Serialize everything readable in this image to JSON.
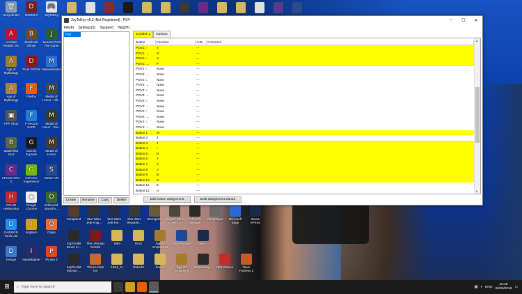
{
  "window": {
    "title": "JoyToKey v6.3 (Not Registered) : PS4",
    "controls": {
      "minimize": "–",
      "maximize": "☐",
      "close": "✕"
    }
  },
  "menu": [
    "File(F)",
    "Settings(S)",
    "Suspend",
    "Help(H)"
  ],
  "profiles": [
    "PS4"
  ],
  "profile_buttons": [
    "Create",
    "Rename",
    "Copy",
    "Delete"
  ],
  "tabs": [
    "Joystick 1",
    "Options"
  ],
  "grid": {
    "headers": [
      "Button",
      "Function",
      "Auto",
      "Comment"
    ],
    "rows": [
      {
        "button": "POV1: ↑",
        "function": "T",
        "auto": "---",
        "hl": true
      },
      {
        "button": "POV1: →",
        "function": "G",
        "auto": "---",
        "hl": true
      },
      {
        "button": "POV1: ↓",
        "function": "V",
        "auto": "---",
        "hl": true
      },
      {
        "button": "POV1: ←",
        "function": "F",
        "auto": "---",
        "hl": true
      },
      {
        "button": "POV2: ↑",
        "function": "None",
        "auto": "---",
        "hl": false
      },
      {
        "button": "POV2: →",
        "function": "None",
        "auto": "---",
        "hl": false
      },
      {
        "button": "POV2: ↓",
        "function": "None",
        "auto": "---",
        "hl": false
      },
      {
        "button": "POV2: ←",
        "function": "None",
        "auto": "---",
        "hl": false
      },
      {
        "button": "POV3: ↑",
        "function": "None",
        "auto": "---",
        "hl": false
      },
      {
        "button": "POV3: →",
        "function": "None",
        "auto": "---",
        "hl": false
      },
      {
        "button": "POV3: ↓",
        "function": "None",
        "auto": "---",
        "hl": false
      },
      {
        "button": "POV3: ←",
        "function": "None",
        "auto": "---",
        "hl": false
      },
      {
        "button": "POV4: ↑",
        "function": "None",
        "auto": "---",
        "hl": false
      },
      {
        "button": "POV4: →",
        "function": "None",
        "auto": "---",
        "hl": false
      },
      {
        "button": "POV4: ↓",
        "function": "None",
        "auto": "---",
        "hl": false
      },
      {
        "button": "POV4: ←",
        "function": "None",
        "auto": "---",
        "hl": false
      },
      {
        "button": "Button 1",
        "function": "M",
        "auto": "---",
        "hl": true
      },
      {
        "button": "Button 2",
        "function": "4",
        "auto": "---",
        "hl": false
      },
      {
        "button": "Button 3",
        "function": "J",
        "auto": "---",
        "hl": true
      },
      {
        "button": "Button 4",
        "function": "I",
        "auto": "---",
        "hl": true
      },
      {
        "button": "Button 5",
        "function": "B",
        "auto": "---",
        "hl": true
      },
      {
        "button": "Button 6",
        "function": "Y",
        "auto": "---",
        "hl": true
      },
      {
        "button": "Button 7",
        "function": "C",
        "auto": "---",
        "hl": true
      },
      {
        "button": "Button 8",
        "function": "V",
        "auto": "---",
        "hl": true
      },
      {
        "button": "Button 9",
        "function": "B",
        "auto": "---",
        "hl": true
      },
      {
        "button": "Button 10",
        "function": "N",
        "auto": "---",
        "hl": true
      },
      {
        "button": "Button 11",
        "function": "E",
        "auto": "---",
        "hl": false
      },
      {
        "button": "Button 12",
        "function": "U",
        "auto": "---",
        "hl": false
      }
    ]
  },
  "assignment_buttons": [
    "Edit button assignment",
    "Bulk assignment wizard"
  ],
  "desktop_icons": [
    {
      "label": "Recycle Bin",
      "color": "#8aa0b8",
      "glyph": "🗑"
    },
    {
      "label": "DOOM 3",
      "color": "#7a1e1e",
      "glyph": "D"
    },
    {
      "label": "JoyToKey",
      "color": "#e6e6e6",
      "glyph": "🎮"
    },
    {
      "label": "Acrobat Reader DC",
      "color": "#c8102e",
      "glyph": "A"
    },
    {
      "label": "BioShock Infinite",
      "color": "#6b4a2e",
      "glyph": "B"
    },
    {
      "label": "Jurassic Park The Game",
      "color": "#2e5d2e",
      "glyph": "J"
    },
    {
      "label": "Age of Mythology",
      "color": "#a87b2c",
      "glyph": "A"
    },
    {
      "label": "Final DOOM",
      "color": "#8b1a1a",
      "glyph": "D"
    },
    {
      "label": "Malwarebytes",
      "color": "#2a6fd6",
      "glyph": "M"
    },
    {
      "label": "Age of Mythology",
      "color": "#b08432",
      "glyph": "A"
    },
    {
      "label": "Firefox",
      "color": "#e66000",
      "glyph": "F"
    },
    {
      "label": "Medal of Honor - Alli...",
      "color": "#4a4a3a",
      "glyph": "M"
    },
    {
      "label": "APP Shop",
      "color": "#555555",
      "glyph": "▣"
    },
    {
      "label": "F-Secure SAFE",
      "color": "#1f7ed6",
      "glyph": "F"
    },
    {
      "label": "Medal of Honor - Bre...",
      "color": "#3a3a2a",
      "glyph": "M"
    },
    {
      "label": "Battlefield 1942",
      "color": "#5a6a3a",
      "glyph": "B"
    },
    {
      "label": "Garmin Express",
      "color": "#1a1a1a",
      "glyph": "G"
    },
    {
      "label": "Medal of Honor",
      "color": "#4a3a2a",
      "glyph": "M"
    },
    {
      "label": "CPUID CPU-Z",
      "color": "#6a2a8a",
      "glyph": "C"
    },
    {
      "label": "GeForce Experience",
      "color": "#76b900",
      "glyph": "G"
    },
    {
      "label": "Steam VR",
      "color": "#2a4a8a",
      "glyph": "S"
    },
    {
      "label": "CPUID HWMonitor",
      "color": "#c82a2a",
      "glyph": "H"
    },
    {
      "label": "Google Chrome",
      "color": "#f0f0f0",
      "glyph": "◉"
    },
    {
      "label": "Oddworld: Munch's...",
      "color": "#3a6a2a",
      "glyph": "O"
    },
    {
      "label": "DAEMON Tools Lite",
      "color": "#1e90ff",
      "glyph": "D"
    },
    {
      "label": "ImgBurn",
      "color": "#d4a017",
      "glyph": "I"
    },
    {
      "label": "Origin",
      "color": "#f56c2d",
      "glyph": "O"
    },
    {
      "label": "Deluge",
      "color": "#3a7ad6",
      "glyph": "D"
    },
    {
      "label": "InputMapper",
      "color": "#2a2a6a",
      "glyph": "I"
    },
    {
      "label": "Picasa 3",
      "color": "#d64a2a",
      "glyph": "P"
    }
  ],
  "row_icons": [
    {
      "label": "Scrapland",
      "color": "#5a3a2a"
    },
    {
      "label": "Star Wars Jedi Knig...",
      "color": "#333333"
    },
    {
      "label": "Star Wars Jedi Kni...",
      "color": "#2a2a4a"
    },
    {
      "label": "Star Wars Republic...",
      "color": "#3a3a3a"
    },
    {
      "label": "Stronghold",
      "color": "#6a5a3a"
    },
    {
      "label": "Project IGI 2 Covert ...",
      "color": "#4a4a3a"
    },
    {
      "label": "7-Zip File Manager",
      "color": "#2a2a2a"
    },
    {
      "label": "Rashplayer",
      "color": "#6a6a6a"
    },
    {
      "label": "Microsoft Edge",
      "color": "#2a6ad6"
    },
    {
      "label": "Steam ePSXe",
      "color": "#1a2a4a"
    },
    {
      "label": "ScpToolkit Driver In...",
      "color": "#2a2a2a"
    },
    {
      "label": "The Ultimate DOOM",
      "color": "#7a1a1a"
    },
    {
      "label": "1964",
      "color": "#d4b85a"
    },
    {
      "label": "Docs",
      "color": "#d4b85a"
    },
    {
      "label": "Age of Empires III",
      "color": "#a87b2c"
    },
    {
      "label": "GameRanger",
      "color": "#1a4a9a"
    },
    {
      "label": "Steam...",
      "color": "#1a2a4a"
    },
    {
      "label": "ScpToolkit Monitor ...",
      "color": "#2a2a2a"
    },
    {
      "label": "Theme Park Inc",
      "color": "#c86a2a"
    },
    {
      "label": "1964_11",
      "color": "#d4b85a"
    },
    {
      "label": "Duke3d",
      "color": "#d4b85a"
    },
    {
      "label": "Sound",
      "color": "#d4b85a"
    },
    {
      "label": "Age Of Empires II",
      "color": "#a87b2c"
    },
    {
      "label": "GameRang...",
      "color": "#2a2a2a"
    },
    {
      "label": "N64 Games",
      "color": "#c82a2a"
    },
    {
      "label": "Team Fortress 2",
      "color": "#c85a2a"
    }
  ],
  "taskbar": {
    "start": "⊞",
    "search_placeholder": "Type here to search",
    "search_icon": "⌕",
    "language": "ENG",
    "time": "15:48",
    "date": "26/09/2018"
  }
}
